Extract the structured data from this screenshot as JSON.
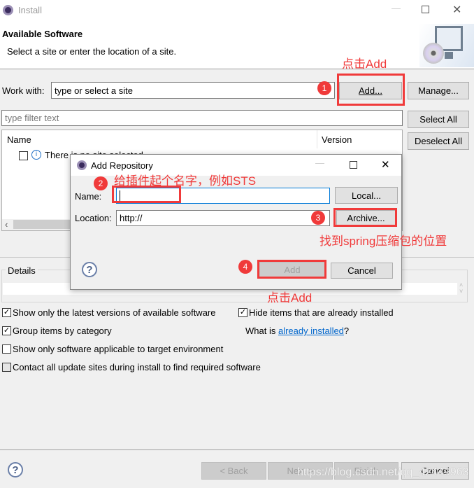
{
  "window": {
    "title": "Install",
    "icon": "eclipse-icon"
  },
  "header": {
    "title": "Available Software",
    "subtitle": "Select a site or enter the location of a site."
  },
  "work_with": {
    "label": "Work with:",
    "value": "type or select a site",
    "add_label": "Add...",
    "manage_label": "Manage..."
  },
  "filter": {
    "placeholder": "type filter text",
    "select_all": "Select All",
    "deselect_all": "Deselect All"
  },
  "table": {
    "columns": [
      "Name",
      "Version"
    ],
    "rows": [
      {
        "text": "There is no site selected.",
        "checked": false
      }
    ]
  },
  "details": {
    "label": "Details"
  },
  "options": [
    {
      "label": "Show only the latest versions of available software",
      "checked": true
    },
    {
      "label": "Hide items that are already installed",
      "checked": true
    },
    {
      "label": "Group items by category",
      "checked": true
    },
    {
      "label": "Show only software applicable to target environment",
      "checked": false
    },
    {
      "label": "Contact all update sites during install to find required software",
      "checked": false
    }
  ],
  "what_is": {
    "prefix": "What is ",
    "link": "already installed",
    "suffix": "?"
  },
  "footer": {
    "back": "< Back",
    "next": "Next >",
    "finish": "Finish",
    "cancel": "Cancel"
  },
  "dialog": {
    "title": "Add Repository",
    "name_label": "Name:",
    "name_value": "",
    "local_label": "Local...",
    "location_label": "Location:",
    "location_value": "http://",
    "archive_label": "Archive...",
    "add_label": "Add",
    "cancel_label": "Cancel"
  },
  "annotations": {
    "a1": "点击Add",
    "a2": "给插件起个名字，例如STS",
    "a3": "找到spring压缩包的位置",
    "a4": "点击Add",
    "n1": "1",
    "n2": "2",
    "n3": "3",
    "n4": "4"
  },
  "watermark": "https://blog.csdn.net/qq_42449963",
  "colors": {
    "annotation": "#f03a3a",
    "link": "#0066cc",
    "focus": "#0078d7"
  }
}
